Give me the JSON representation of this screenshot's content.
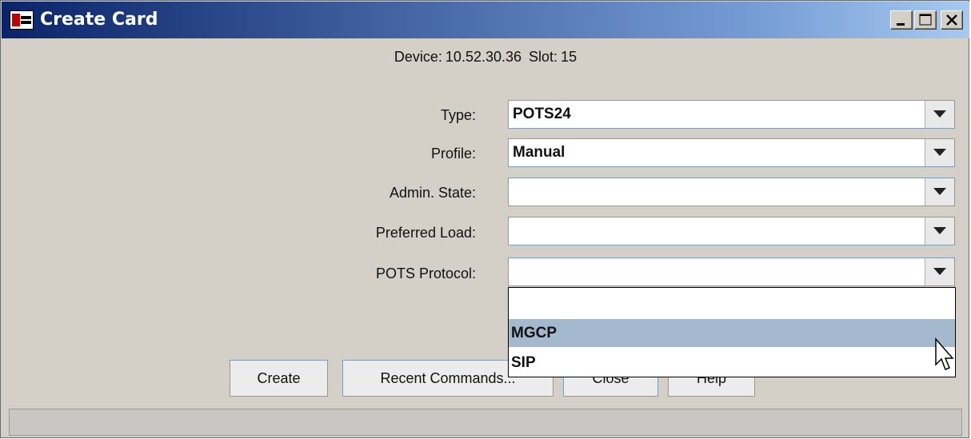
{
  "window": {
    "title": "Create Card",
    "controls": {
      "minimize": "minimize-icon",
      "maximize": "maximize-icon",
      "close": "close-icon"
    }
  },
  "header": {
    "device_label": "Device:",
    "device_value": "10.52.30.36",
    "slot_label": "Slot:",
    "slot_value": "15"
  },
  "form": {
    "type": {
      "label": "Type:",
      "value": "POTS24"
    },
    "profile": {
      "label": "Profile:",
      "value": "Manual"
    },
    "admin_state": {
      "label": "Admin. State:",
      "value": ""
    },
    "preferred_load": {
      "label": "Preferred Load:",
      "value": ""
    },
    "pots_protocol": {
      "label": "POTS Protocol:",
      "value": ""
    }
  },
  "dropdown": {
    "options": [
      "",
      "MGCP",
      "SIP"
    ],
    "highlighted": "MGCP"
  },
  "buttons": {
    "create": "Create",
    "recent_commands": "Recent Commands...",
    "close": "Close",
    "help": "Help"
  },
  "colors": {
    "titlebar_start": "#0a246a",
    "titlebar_end": "#a6caf0",
    "window_bg": "#d4d0c8",
    "highlight": "#a5b9ce"
  }
}
